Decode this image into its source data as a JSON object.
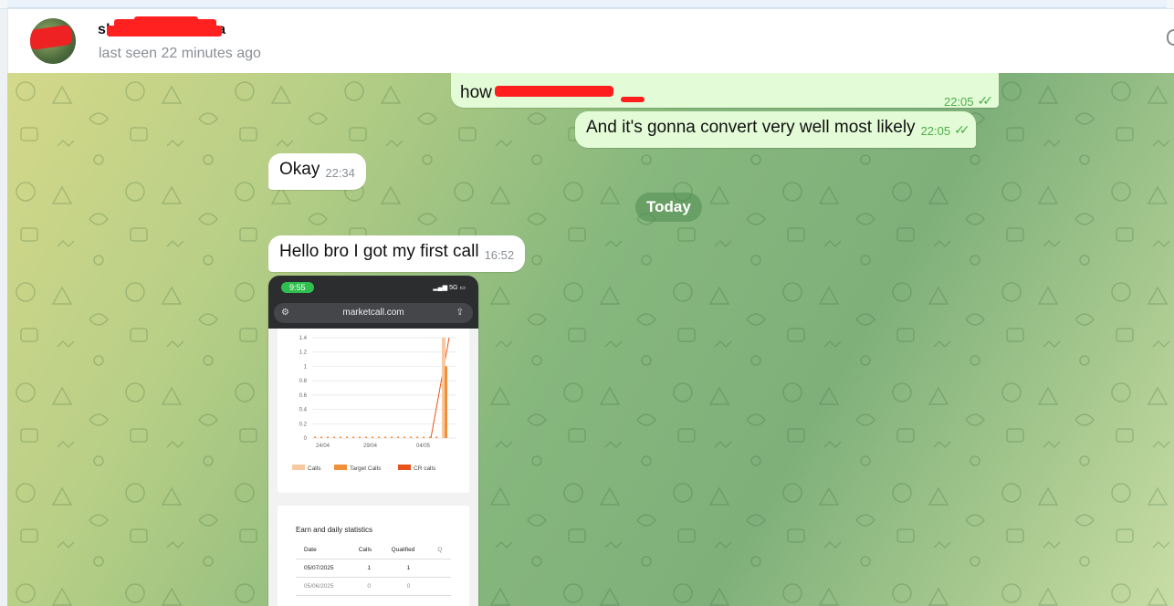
{
  "header": {
    "name_visible": "sh",
    "name_tail": "a",
    "status": "last seen 22 minutes ago"
  },
  "messages": [
    {
      "id": "m1",
      "direction": "out",
      "text_start": "how ",
      "time": "22:05",
      "read": true
    },
    {
      "id": "m2",
      "direction": "out",
      "text": "And it's gonna convert very well most likely",
      "time": "22:05",
      "read": true
    },
    {
      "id": "m3",
      "direction": "in",
      "text": "Okay",
      "time": "22:34"
    },
    {
      "id": "m4",
      "direction": "in",
      "text": "Hello bro I got my first call",
      "time": "16:52"
    }
  ],
  "day_separator": "Today",
  "screenshot": {
    "clock": "9:55",
    "signal": "5G",
    "url": "marketcall.com",
    "chart_data": {
      "type": "bar",
      "x_tick_labels": [
        "24/04",
        "29/04",
        "04/05"
      ],
      "y_tick_labels": [
        "1.4",
        "1.2",
        "1",
        "0.8",
        "0.6",
        "0.4",
        "0.2",
        "0"
      ],
      "ylim": [
        0,
        1.4
      ],
      "legend": [
        "Calls",
        "Target Calls",
        "CR calls"
      ],
      "series": [
        {
          "name": "Calls",
          "color": "#f7c9a0"
        },
        {
          "name": "Target Calls",
          "color": "#f0913a"
        },
        {
          "name": "CR calls",
          "color": "#e8531c"
        }
      ]
    },
    "stats": {
      "title": "Earn and daily statistics",
      "columns": [
        "Date",
        "Calls",
        "Qualified",
        "Q"
      ],
      "rows": [
        [
          "05/07/2025",
          "1",
          "1"
        ],
        [
          "05/06/2025",
          "0",
          "0"
        ]
      ]
    }
  }
}
